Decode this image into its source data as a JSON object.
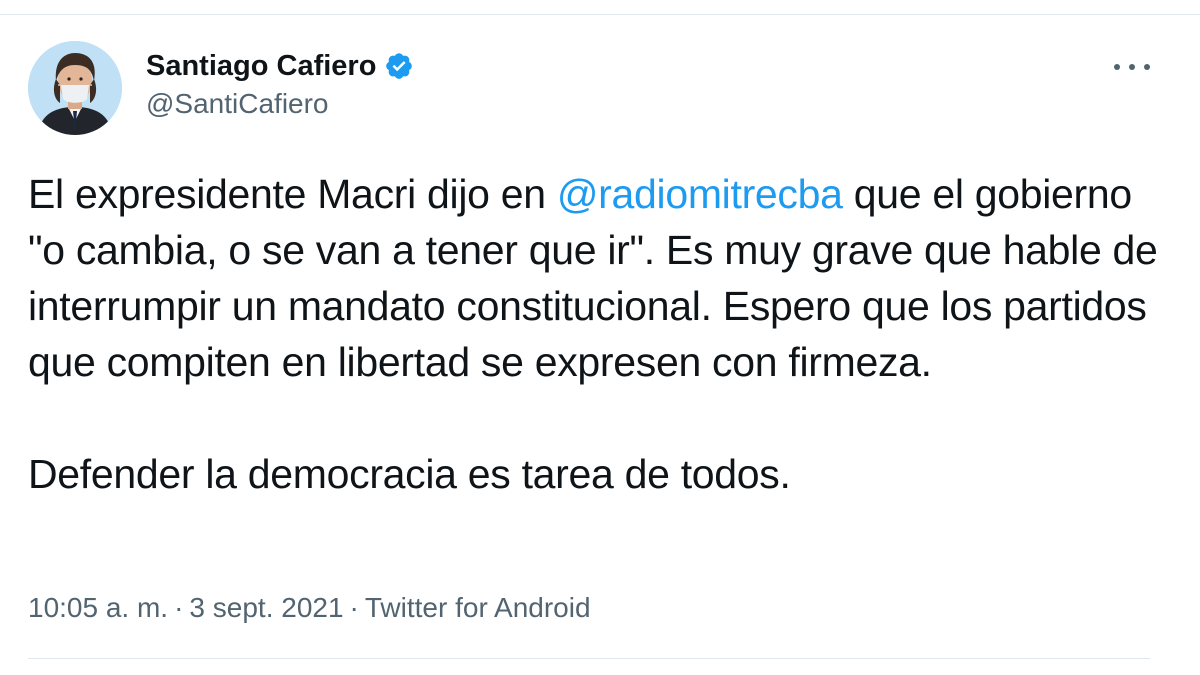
{
  "author": {
    "display_name": "Santiago Cafiero",
    "handle": "@SantiCafiero",
    "verified_icon": "verified-badge-icon",
    "avatar_icon": "profile-photo"
  },
  "tweet": {
    "segments": {
      "line1_prefix": "El expresidente Macri dijo en ",
      "mention": "@radiomitrecba",
      "line1_suffix": " que el gobierno \"o cambia, o se van a tener que ir\". Es muy grave que hable de interrumpir un mandato constitucional. Espero que los partidos que compiten en libertad se expresen con firmeza.",
      "paragraph2": "Defender la democracia es tarea de todos."
    }
  },
  "meta": {
    "time": "10:05 a. m.",
    "separator": "·",
    "date": "3 sept. 2021",
    "source": "Twitter for Android"
  },
  "actions": {
    "more_icon": "more-horizontal-icon"
  },
  "colors": {
    "text": "#0f1419",
    "secondary": "#536471",
    "accent": "#1d9bf0",
    "divider": "#e1e8ed"
  }
}
